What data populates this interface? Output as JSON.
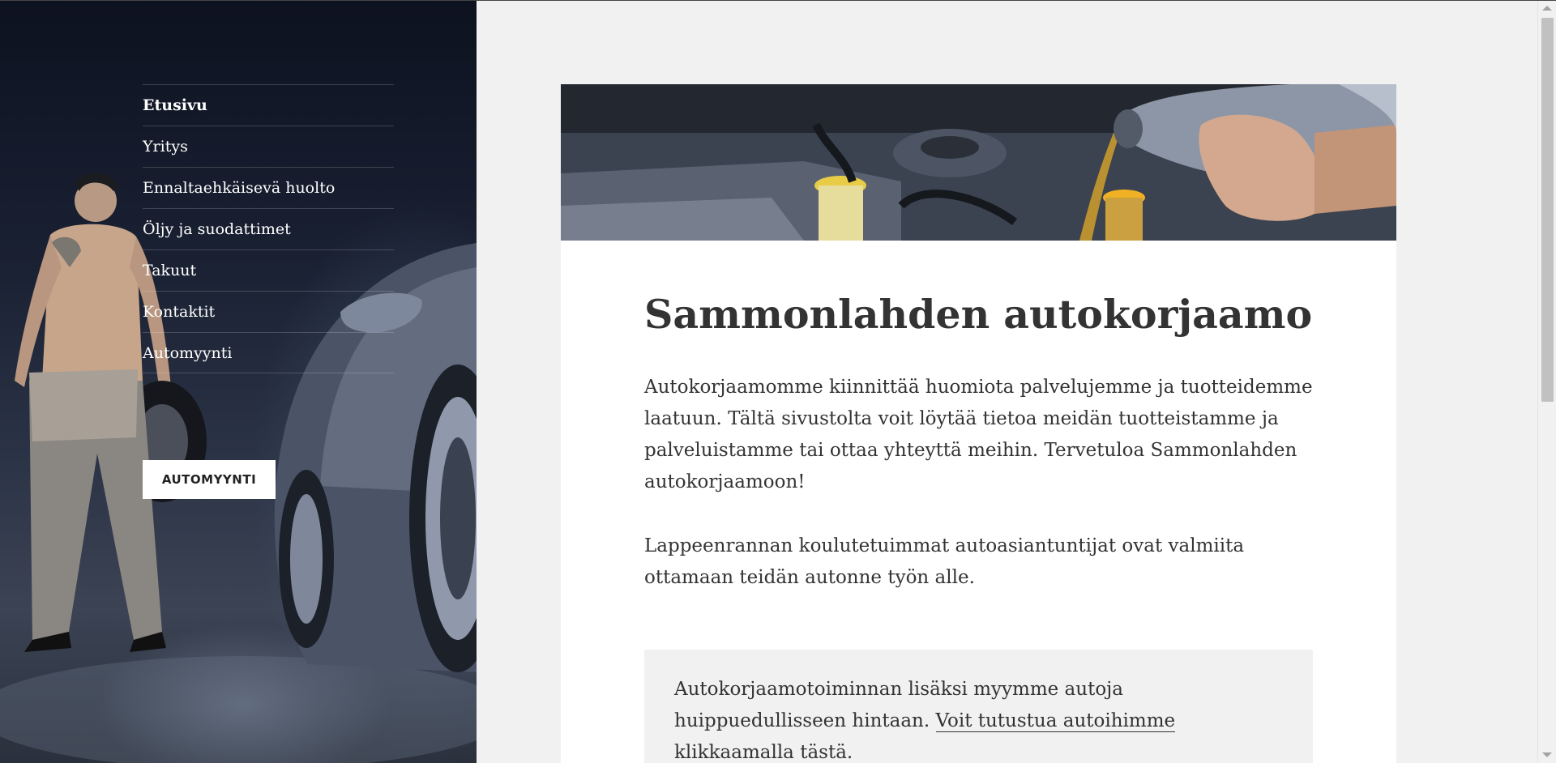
{
  "nav": {
    "items": [
      {
        "label": "Etusivu",
        "active": true
      },
      {
        "label": "Yritys",
        "active": false
      },
      {
        "label": "Ennaltaehkäisevä huolto",
        "active": false
      },
      {
        "label": "Öljy ja suodattimet",
        "active": false
      },
      {
        "label": "Takuut",
        "active": false
      },
      {
        "label": "Kontaktit",
        "active": false
      },
      {
        "label": "Automyynti",
        "active": false
      }
    ],
    "button_label": "AUTOMYYNTI"
  },
  "article": {
    "title": "Sammonlahden autokorjaamo",
    "paragraph1": "Autokorjaamomme kiinnittää huomiota palvelujemme ja tuotteidemme laatuun. Tältä sivustolta voit löytää tietoa meidän tuotteistamme ja palveluistamme tai ottaa yhteyttä meihin. Tervetuloa Sammonlahden autokorjaamoon!",
    "paragraph2": "Lappeenrannan koulutetuimmat autoasiantuntijat ovat valmiita ottamaan teidän autonne työn alle.",
    "callout_text": "Autokorjaamotoiminnan lisäksi myymme autoja huippuedullisseen hintaan. ",
    "callout_link": "Voit tutustua autoihimme klikkaamalla tästä."
  },
  "colors": {
    "sidebar_dark": "#1a2133",
    "content_bg": "#ffffff",
    "page_bg": "#f1f1f1",
    "text": "#333333"
  }
}
